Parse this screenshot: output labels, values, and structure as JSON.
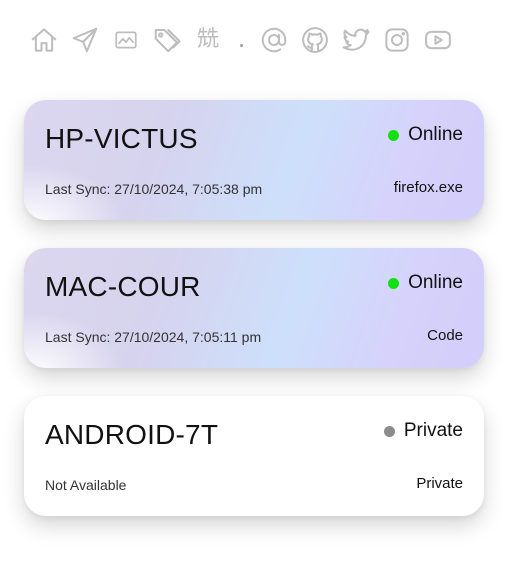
{
  "nav": {
    "icons": [
      "home-icon",
      "send-icon",
      "image-icon",
      "tags-icon",
      "logo-glyph-icon",
      "at-icon",
      "github-icon",
      "twitter-icon",
      "instagram-icon",
      "youtube-icon"
    ],
    "logo_glyph": "兟"
  },
  "devices": [
    {
      "name": "HP-VICTUS",
      "status": "Online",
      "status_color": "#12e012",
      "last_sync": "Last Sync: 27/10/2024, 7:05:38 pm",
      "app": "firefox.exe"
    },
    {
      "name": "MAC-COUR",
      "status": "Online",
      "status_color": "#12e012",
      "last_sync": "Last Sync: 27/10/2024, 7:05:11 pm",
      "app": "Code"
    },
    {
      "name": "ANDROID-7T",
      "status": "Private",
      "status_color": "#8c8c8c",
      "last_sync": "Not Available",
      "app": "Private"
    }
  ]
}
